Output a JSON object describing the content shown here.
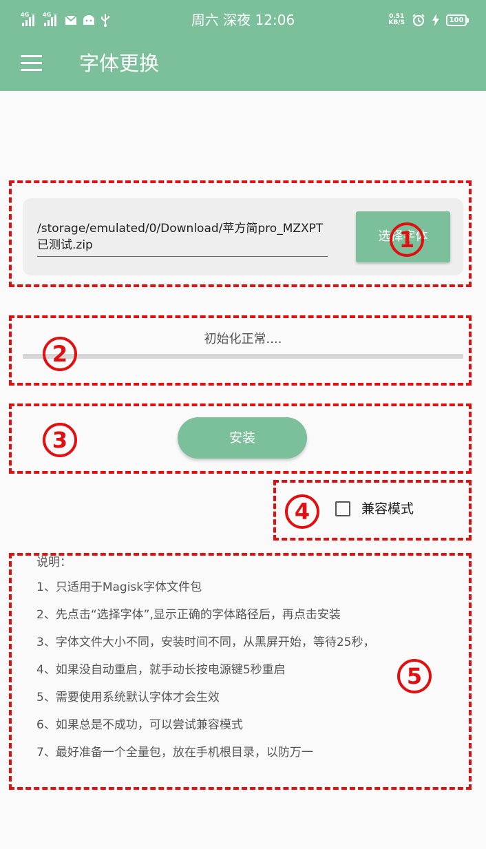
{
  "status_bar": {
    "network": [
      "4G",
      "4G"
    ],
    "time": "周六 深夜 12:06",
    "speed_value": "0.51",
    "speed_unit": "KB/S",
    "battery": "100"
  },
  "app_bar": {
    "title": "字体更换"
  },
  "file_picker": {
    "path": "/storage/emulated/0/Download/苹方简pro_MZXPT已测试.zip",
    "select_button": "选择字体"
  },
  "progress": {
    "status": "初始化正常....",
    "fraction": 0
  },
  "install_button": "安装",
  "compat_mode": {
    "label": "兼容模式",
    "checked": false
  },
  "notes": {
    "heading": "说明：",
    "items": [
      "1、只适用于Magisk字体文件包",
      "2、先点击“选择字体”,显示正确的字体路径后，再点击安装",
      "3、字体文件大小不同，安装时间不同，从黑屏开始，等待25秒，",
      "4、如果没自动重启，就手动长按电源键5秒重启",
      "5、需要使用系统默认字体才会生效",
      "6、如果总是不成功，可以尝试兼容模式",
      "7、最好准备一个全量包，放在手机根目录，以防万一"
    ]
  },
  "annotations": [
    "1",
    "2",
    "3",
    "4",
    "5"
  ],
  "colors": {
    "accent": "#7bbf9b",
    "annotation": "#e01010"
  }
}
